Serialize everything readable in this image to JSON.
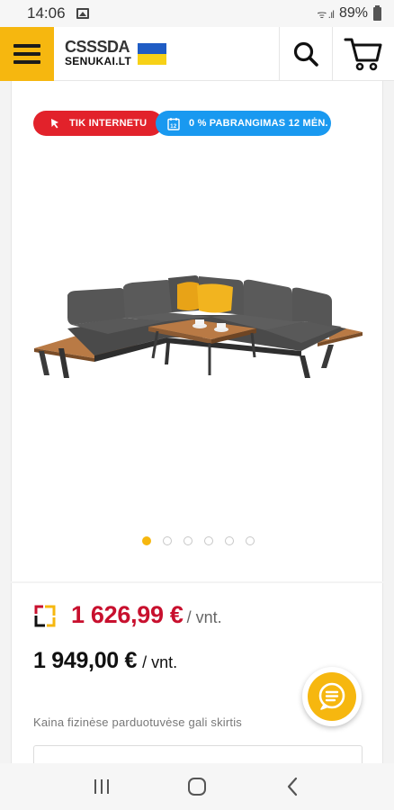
{
  "status_bar": {
    "time": "14:06",
    "signal_text": "ᯤ .ıl",
    "battery": "89%"
  },
  "header": {
    "logo_top": "CSSSDA",
    "logo_bottom": "SENUKAI.LT"
  },
  "badges": {
    "online_only": "TIK INTERNETU",
    "installments": "0 % PABRANGIMAS 12 MĖN."
  },
  "carousel": {
    "slide_count": 6,
    "active_index": 0
  },
  "price": {
    "special": "1 626,99 €",
    "special_unit": "/ vnt.",
    "regular": "1 949,00 €",
    "regular_unit": "/ vnt.",
    "note": "Kaina fizinėse parduotuvėse gali skirtis"
  },
  "colors": {
    "accent_yellow": "#f6b70f",
    "badge_red": "#e2222b",
    "badge_blue": "#1999f0",
    "price_red": "#c8102e"
  }
}
